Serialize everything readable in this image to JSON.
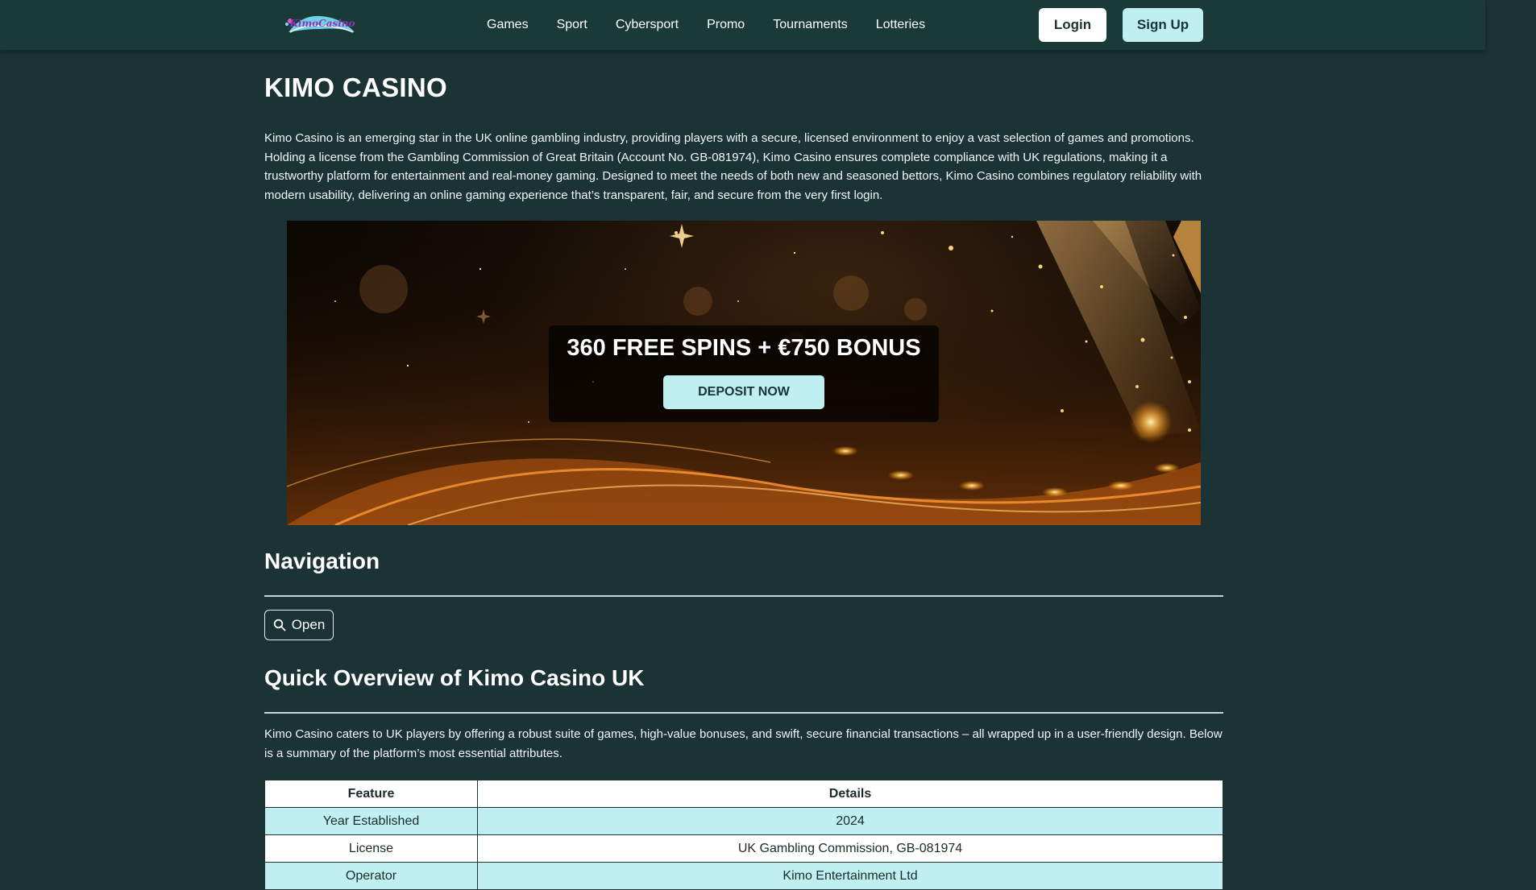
{
  "header": {
    "logo_text": "KimoCasino",
    "nav": [
      {
        "label": "Games"
      },
      {
        "label": "Sport"
      },
      {
        "label": "Cybersport"
      },
      {
        "label": "Promo"
      },
      {
        "label": "Tournaments"
      },
      {
        "label": "Lotteries"
      }
    ],
    "login_label": "Login",
    "signup_label": "Sign Up"
  },
  "page": {
    "title": "KIMO CASINO",
    "intro": "Kimo Casino is an emerging star in the UK online gambling industry, providing players with a secure, licensed environment to enjoy a vast selection of games and promotions. Holding a license from the Gambling Commission of Great Britain (Account No. GB-081974), Kimo Casino ensures complete compliance with UK regulations, making it a trustworthy platform for entertainment and real-money gaming. Designed to meet the needs of both new and seasoned bettors, Kimo Casino combines regulatory reliability with modern usability, delivering an online gaming experience that’s transparent, fair, and secure from the very first login."
  },
  "banner": {
    "headline": "360 FREE SPINS + €750 BONUS",
    "cta_label": "DEPOSIT NOW"
  },
  "navigation_section": {
    "title": "Navigation",
    "open_label": "Open"
  },
  "overview": {
    "title": "Quick Overview of Kimo Casino UK",
    "text": "Kimo Casino caters to UK players by offering a robust suite of games, high-value bonuses, and swift, secure financial transactions – all wrapped up in a user-friendly design. Below is a summary of the platform’s most essential attributes.",
    "table": {
      "headers": [
        "Feature",
        "Details"
      ],
      "rows": [
        [
          "Year Established",
          "2024"
        ],
        [
          "License",
          "UK Gambling Commission, GB-081974"
        ],
        [
          "Operator",
          "Kimo Entertainment Ltd"
        ]
      ]
    }
  },
  "colors": {
    "background": "#1b3335",
    "header": "#1a3a38",
    "accent": "#bfeff0"
  }
}
